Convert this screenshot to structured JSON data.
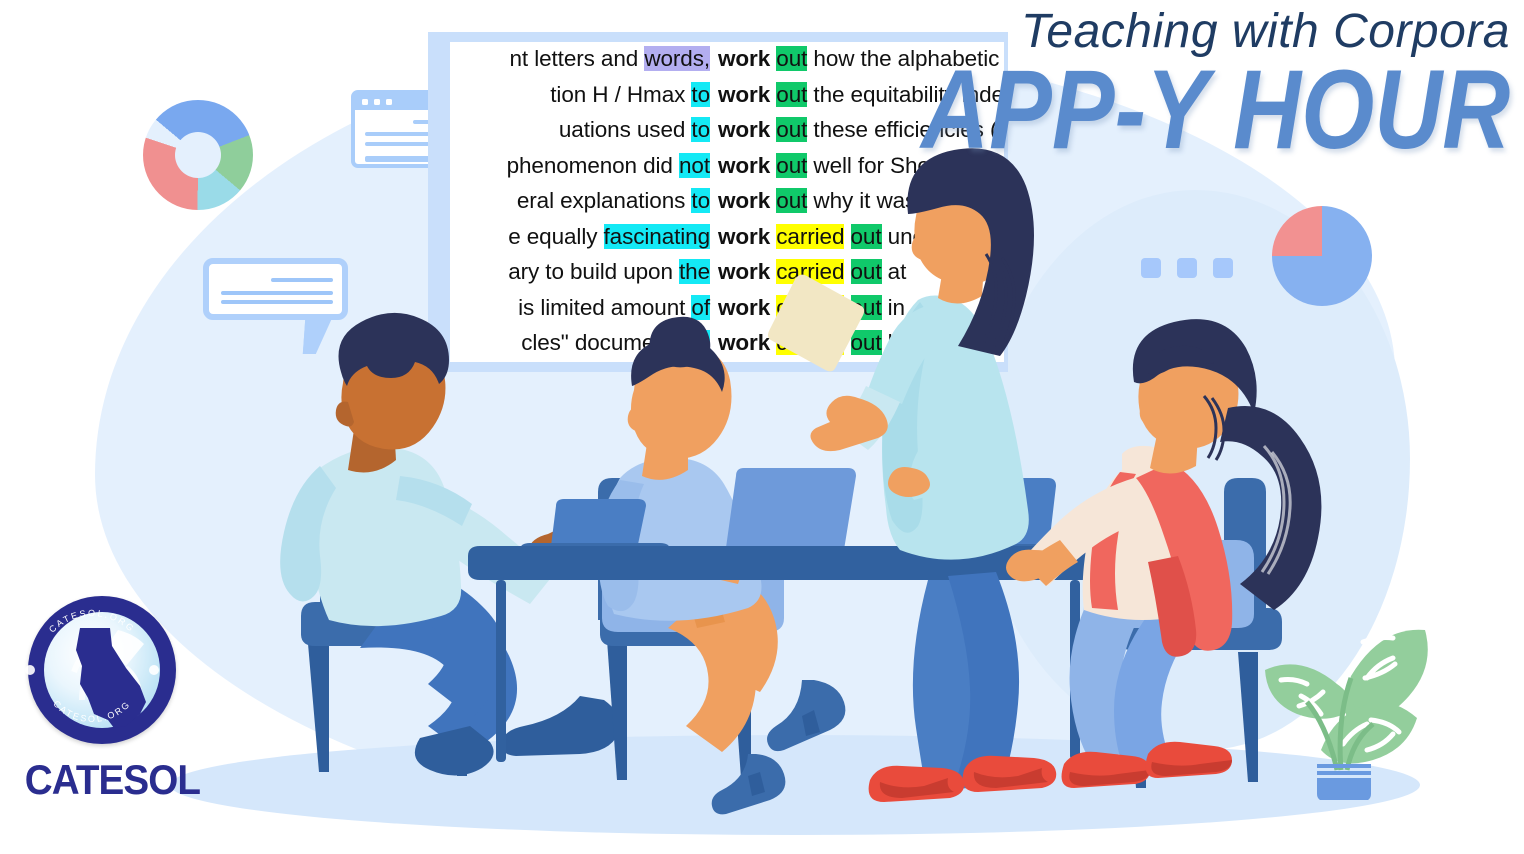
{
  "title": {
    "kicker": "Teaching with Corpora",
    "headline": "APP-Y HOUR",
    "kicker_color": "#1f3c63",
    "headline_color": "#5a8bcd"
  },
  "brand": {
    "name": "CATESOL",
    "seal_text_top": "CATESOL.ORG",
    "seal_text_bottom": "CATESOL.ORG",
    "seal_color": "#2a2d8f"
  },
  "concordance": {
    "panel_frame_color": "#c9dffb",
    "sheet_color": "#ffffff",
    "node_word": "work",
    "highlight_colors": {
      "purple": "#b3aef0",
      "cyan": "#14e9f5",
      "green": "#10c96a",
      "yellow": "#ffff00"
    },
    "rows": [
      {
        "left": "nt letters and ",
        "left_hl": "words,",
        "left_hl_color": "purple",
        "node": "work",
        "right_hl": "out",
        "right_hl_color": "green",
        "right": " how the alphabetic"
      },
      {
        "left": "tion H / Hmax ",
        "left_hl": "to",
        "left_hl_color": "cyan",
        "node": "work",
        "right_hl": "out",
        "right_hl_color": "green",
        "right": " the equitability inde"
      },
      {
        "left": "uations used ",
        "left_hl": "to",
        "left_hl_color": "cyan",
        "node": "work",
        "right_hl": "out",
        "right_hl_color": "green",
        "right": " these efficiencies (s"
      },
      {
        "left": "phenomenon did ",
        "left_hl": "not",
        "left_hl_color": "cyan",
        "node": "work",
        "right_hl": "out",
        "right_hl_color": "green",
        "right": " well for Shostak as"
      },
      {
        "left": "eral explanations ",
        "left_hl": "to",
        "left_hl_color": "cyan",
        "node": "work",
        "right_hl": "out",
        "right_hl_color": "green",
        "right": " why it was necessa"
      },
      {
        "left": "e equally ",
        "left_hl": "fascinating",
        "left_hl_color": "cyan",
        "node": "work",
        "mid_hl": "carried",
        "mid_hl_color": "yellow",
        "right_hl": "out",
        "right_hl_color": "green",
        "right": " under D"
      },
      {
        "left": "ary to build upon ",
        "left_hl": "the",
        "left_hl_color": "cyan",
        "node": "work",
        "mid_hl": "carried",
        "mid_hl_color": "yellow",
        "right_hl": "out",
        "right_hl_color": "green",
        "right": " at"
      },
      {
        "left": "is limited amount ",
        "left_hl": "of",
        "left_hl_color": "cyan",
        "node": "work",
        "mid_hl": "carried",
        "mid_hl_color": "yellow",
        "right_hl": "out",
        "right_hl_color": "green",
        "right": " in"
      },
      {
        "left": "cles\" document ",
        "left_hl": "the",
        "left_hl_color": "cyan",
        "node": "work",
        "mid_hl": "carried",
        "mid_hl_color": "yellow",
        "right_hl": "out",
        "right_hl_color": "green",
        "right": " by"
      }
    ]
  },
  "decorations": {
    "donut": {
      "label": "donut-chart",
      "segments": [
        {
          "name": "blue",
          "color": "#79a8ef",
          "percent": 33
        },
        {
          "name": "green",
          "color": "#8fce9b",
          "percent": 17
        },
        {
          "name": "light-blue",
          "color": "#9adbe8",
          "percent": 14
        },
        {
          "name": "red",
          "color": "#f09090",
          "percent": 30
        },
        {
          "name": "gap",
          "color": "#e4f0fd",
          "percent": 6
        }
      ]
    },
    "pie": {
      "label": "pie-chart",
      "segments": [
        {
          "name": "blue",
          "color": "#86b1f0",
          "percent": 75
        },
        {
          "name": "red",
          "color": "#f29191",
          "percent": 25
        }
      ]
    },
    "browser_card": {
      "label": "browser-window-mockup",
      "color": "#a9cdfa"
    },
    "speech_bubble": {
      "label": "chat-bubble",
      "color": "#afd0fb"
    },
    "dots": {
      "label": "three-dots",
      "count": 3,
      "color": "#a6c8fb"
    },
    "plant": {
      "label": "monstera-plant",
      "leaf_color": "#93ce9c",
      "pot_color": "#6a9ae0"
    }
  },
  "scene": {
    "label": "flat-illustration-team-at-table",
    "people": [
      {
        "id": "person-left",
        "description": "man seated, light blue shirt, blue trousers"
      },
      {
        "id": "person-center",
        "description": "woman seated at laptop, blue blouse, hair bun"
      },
      {
        "id": "person-standing",
        "description": "woman standing, mint blouse, blue jeans, red flats"
      },
      {
        "id": "person-right",
        "description": "woman seated at laptop, red vest, ponytail"
      }
    ],
    "furniture": [
      "table",
      "chair-left",
      "chair-center",
      "chair-right",
      "laptop-left",
      "laptop-center",
      "laptop-right"
    ],
    "palette": {
      "table": "#31619f",
      "chair": "#2f5e9c",
      "skin_dark": "#b4652e",
      "skin_light": "#f0a060",
      "skin_pale": "#f6e6d8",
      "hair_navy": "#2c3359",
      "shirt_mint": "#b8e4ee",
      "shirt_blue": "#a9c8f0",
      "denim": "#4a7ec4",
      "vest_red": "#f0675e"
    }
  }
}
